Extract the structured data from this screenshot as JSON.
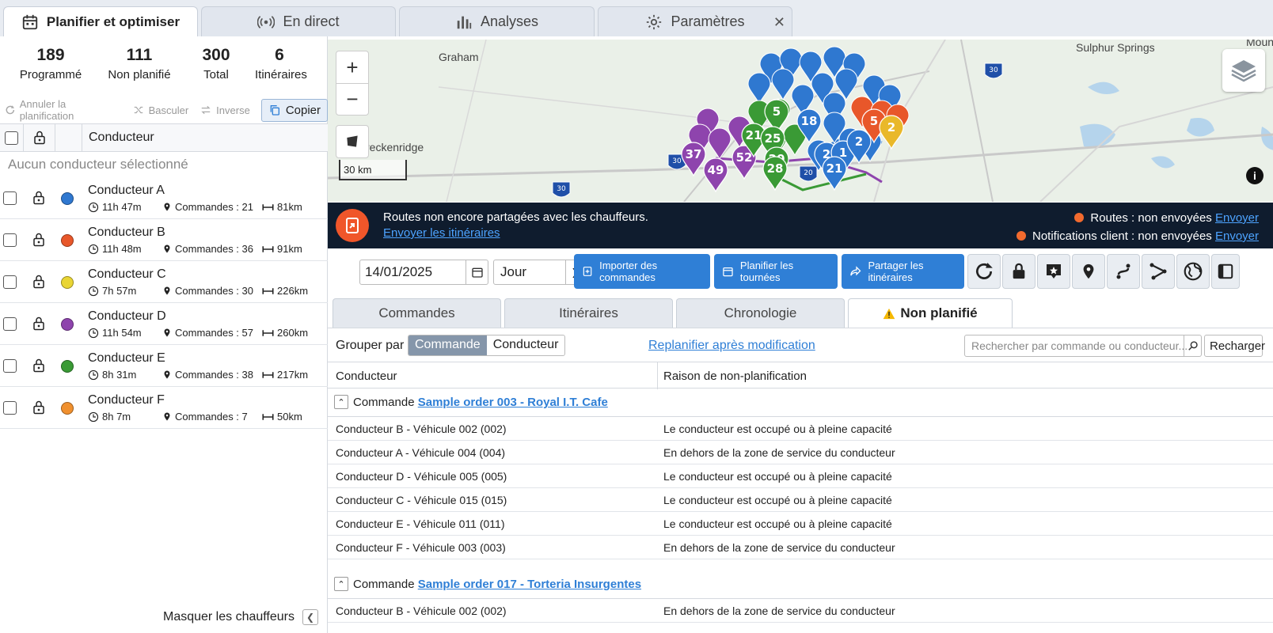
{
  "top_tabs": [
    {
      "label": "Planifier et optimiser",
      "icon": "calendar-icon"
    },
    {
      "label": "En direct",
      "icon": "broadcast-icon"
    },
    {
      "label": "Analyses",
      "icon": "bar-chart-icon"
    },
    {
      "label": "Paramètres",
      "icon": "gear-icon"
    }
  ],
  "close_glyph": "✕",
  "stats": [
    {
      "value": "189",
      "label": "Programmé"
    },
    {
      "value": "111",
      "label": "Non planifié"
    },
    {
      "value": "300",
      "label": "Total"
    },
    {
      "value": "6",
      "label": "Itinéraires"
    }
  ],
  "toolbar_left": {
    "unplan": "Annuler la planification",
    "swap": "Basculer",
    "reverse": "Inverse",
    "copy": "Copier"
  },
  "driver_header": "Conducteur",
  "no_driver_selected": "Aucun conducteur sélectionné",
  "drivers": [
    {
      "name": "Conducteur A",
      "time": "11h 47m",
      "orders": "Commandes : 21",
      "distance": "81km",
      "color": "#2f78d0"
    },
    {
      "name": "Conducteur B",
      "time": "11h 48m",
      "orders": "Commandes : 36",
      "distance": "91km",
      "color": "#e8572a"
    },
    {
      "name": "Conducteur C",
      "time": "7h 57m",
      "orders": "Commandes : 30",
      "distance": "226km",
      "color": "#e9d534"
    },
    {
      "name": "Conducteur D",
      "time": "11h 54m",
      "orders": "Commandes : 57",
      "distance": "260km",
      "color": "#8e44ad"
    },
    {
      "name": "Conducteur E",
      "time": "8h 31m",
      "orders": "Commandes : 38",
      "distance": "217km",
      "color": "#3a9a35"
    },
    {
      "name": "Conducteur F",
      "time": "8h 7m",
      "orders": "Commandes : 7",
      "distance": "50km",
      "color": "#f0902e"
    }
  ],
  "hide_drivers": "Masquer les chauffeurs",
  "map": {
    "labels": [
      "Graham",
      "Sulphur Springs",
      "reckenridge",
      "Moun"
    ],
    "highway_labels": [
      "30",
      "30",
      "20",
      "30"
    ],
    "zoom_in": "+",
    "zoom_out": "−",
    "scale": "30 km",
    "pin_numbers": [
      "5",
      "18",
      "37",
      "49",
      "52",
      "21",
      "25",
      "20",
      "28",
      "2",
      "1",
      "21",
      "2",
      "5",
      "2"
    ]
  },
  "banner": {
    "message": "Routes non encore partagées avec les chauffeurs.",
    "link": "Envoyer les itinéraires",
    "routes_status": "Routes : non envoyées",
    "notif_status": "Notifications client : non envoyées",
    "send": "Envoyer"
  },
  "toolbar": {
    "date": "14/01/2025",
    "period": "Jour",
    "import": "Importer des commandes",
    "plan": "Planifier les tournées",
    "share": "Partager les itinéraires"
  },
  "content_tabs": [
    "Commandes",
    "Itinéraires",
    "Chronologie",
    "Non planifié"
  ],
  "group_by": {
    "label": "Grouper par",
    "options": [
      "Commande",
      "Conducteur"
    ],
    "selected": "Commande"
  },
  "replan_link": "Replanifier après modification",
  "search_placeholder": "Rechercher par commande ou conducteur...",
  "reload": "Recharger",
  "table_headers": [
    "Conducteur",
    "Raison de non-planification"
  ],
  "groups": [
    {
      "prefix": "Commande",
      "order": "Sample order 003 - Royal I.T. Cafe",
      "rows": [
        {
          "driver": "Conducteur B - Véhicule 002 (002)",
          "reason": "Le conducteur est occupé ou à pleine capacité"
        },
        {
          "driver": "Conducteur A - Véhicule 004 (004)",
          "reason": "En dehors de la zone de service du conducteur"
        },
        {
          "driver": "Conducteur D - Véhicule 005 (005)",
          "reason": "Le conducteur est occupé ou à pleine capacité"
        },
        {
          "driver": "Conducteur C - Véhicule 015 (015)",
          "reason": "Le conducteur est occupé ou à pleine capacité"
        },
        {
          "driver": "Conducteur E - Véhicule 011 (011)",
          "reason": "Le conducteur est occupé ou à pleine capacité"
        },
        {
          "driver": "Conducteur F - Véhicule 003 (003)",
          "reason": "En dehors de la zone de service du conducteur"
        }
      ]
    },
    {
      "prefix": "Commande",
      "order": "Sample order 017 - Torteria Insurgentes",
      "rows": [
        {
          "driver": "Conducteur B - Véhicule 002 (002)",
          "reason": "En dehors de la zone de service du conducteur"
        }
      ]
    }
  ]
}
